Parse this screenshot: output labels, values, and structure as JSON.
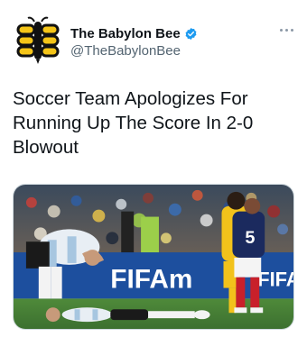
{
  "account": {
    "display_name": "The Babylon Bee",
    "handle": "@TheBabylonBee",
    "verified": true
  },
  "tweet": {
    "text": "Soccer Team Apologizes For Running Up The Score In 2-0 Blowout"
  },
  "media": {
    "board_text_1": "FIFAm",
    "board_text_2": "FIFAm",
    "jersey_number": "5"
  },
  "icons": [
    "bee-logo-icon",
    "verified-badge-icon",
    "more-options-icon"
  ],
  "colors": {
    "verified": "#1d9bf0",
    "avatar_yellow": "#f5c518",
    "board_blue": "#1d4f9e"
  }
}
